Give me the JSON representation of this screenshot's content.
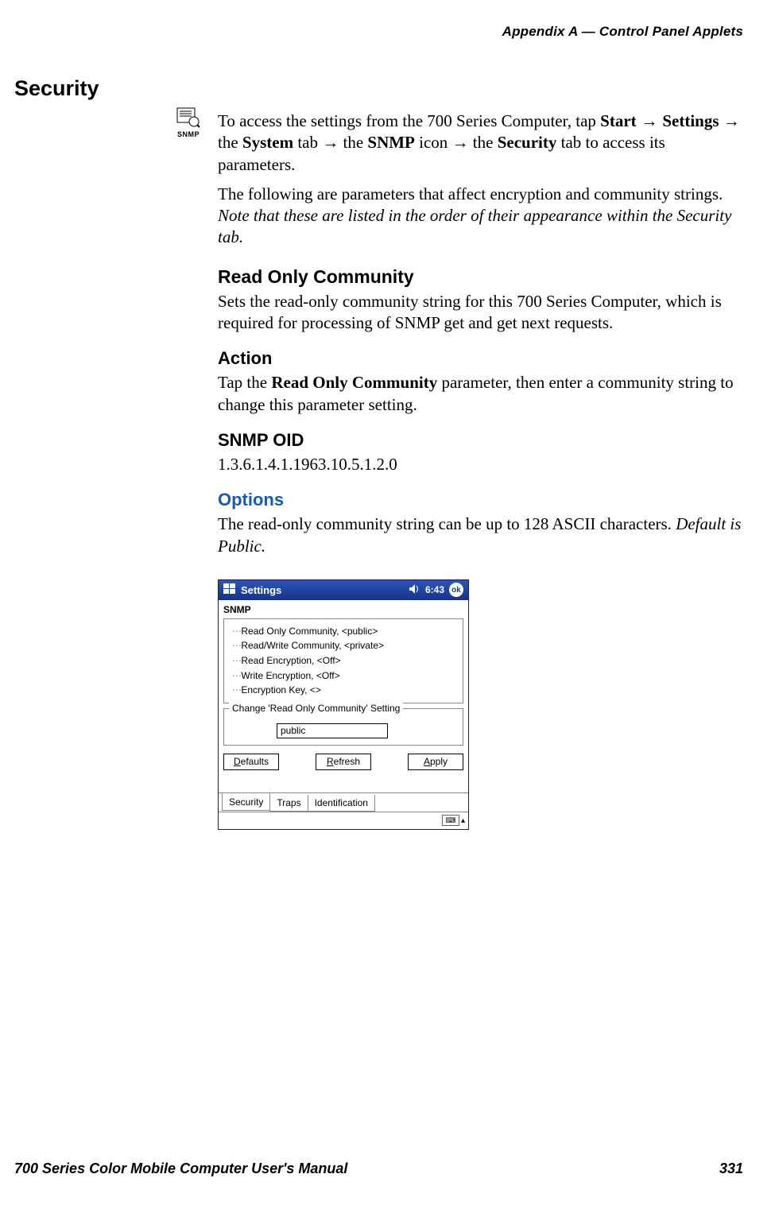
{
  "header": {
    "running": "Appendix A   —   Control Panel Applets"
  },
  "title": "Security",
  "icon_label": "SNMP",
  "intro": {
    "pre": "To access the settings from the 700 Series Computer, tap ",
    "b1": "Start",
    "arrow": " → ",
    "b2": "Settings",
    "mid1": " → the ",
    "b3": "System",
    "mid2": " tab → the ",
    "b4": "SNMP",
    "mid3": " icon → the ",
    "b5": "Security",
    "post": " tab to access its parameters."
  },
  "intro2_a": "The following are parameters that affect encryption and community strings. ",
  "intro2_b": "Note that these are listed in the order of their appearance within the Security tab.",
  "roc": {
    "title": "Read Only Community",
    "text": "Sets the read-only community string for this 700 Series Computer, which is required for processing of SNMP get and get next requests."
  },
  "action": {
    "title": "Action",
    "pre": "Tap the ",
    "b": "Read Only Community",
    "post": " parameter, then enter a community string to change this parameter setting."
  },
  "oid": {
    "title": "SNMP OID",
    "value": "1.3.6.1.4.1.1963.10.5.1.2.0"
  },
  "options": {
    "title": "Options",
    "pre": "The read-only community string can be up to 128 ASCII characters. ",
    "ital": "Default is Public."
  },
  "shot": {
    "window_title": "Settings",
    "clock": "6:43",
    "ok": "ok",
    "applet": "SNMP",
    "tree": [
      "Read Only Community, <public>",
      "Read/Write Community, <private>",
      "Read Encryption, <Off>",
      "Write Encryption, <Off>",
      "Encryption Key, <>"
    ],
    "group_legend": "Change 'Read Only Community' Setting",
    "input_value": "public",
    "buttons": {
      "defaults": "Defaults",
      "refresh": "Refresh",
      "apply": "Apply"
    },
    "tabs": [
      "Security",
      "Traps",
      "Identification"
    ]
  },
  "footer": {
    "left": "700 Series Color Mobile Computer User's Manual",
    "right": "331"
  }
}
